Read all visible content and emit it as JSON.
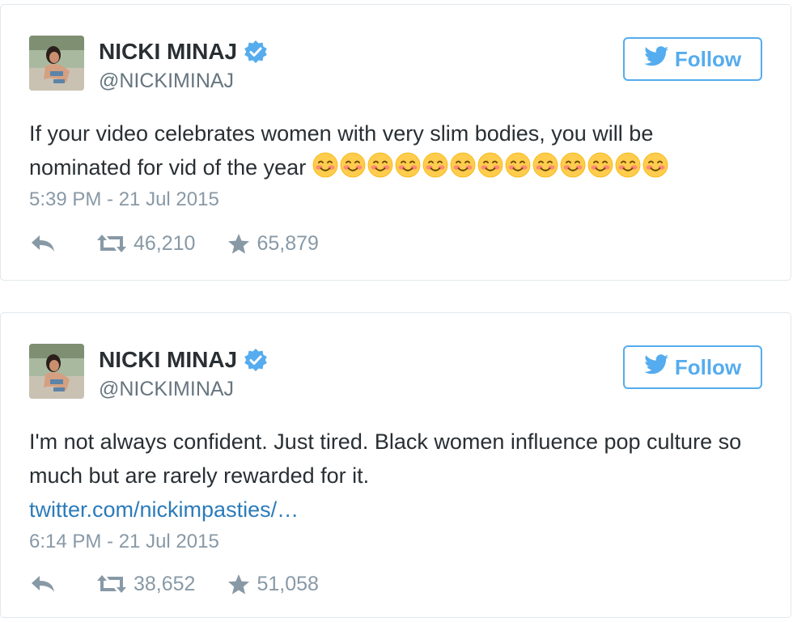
{
  "tweets": [
    {
      "author_name": "NICKI MINAJ",
      "handle": "@NICKIMINAJ",
      "follow_label": "Follow",
      "text": "If your video celebrates women with very slim bodies, you will be nominated for vid of the year",
      "emoji": [
        "blush",
        "blush",
        "blush",
        "blush",
        "blush",
        "blush",
        "blush",
        "blush",
        "blush",
        "blush",
        "blush",
        "blush",
        "blush"
      ],
      "link": "",
      "timestamp": "5:39 PM - 21 Jul 2015",
      "retweets": "46,210",
      "favorites": "65,879"
    },
    {
      "author_name": "NICKI MINAJ",
      "handle": "@NICKIMINAJ",
      "follow_label": "Follow",
      "text": "I'm not always confident.  Just tired. Black women influence pop culture so much but are rarely rewarded for it.",
      "emoji": [],
      "link": "twitter.com/nickimpasties/…",
      "timestamp": "6:14 PM - 21 Jul 2015",
      "retweets": "38,652",
      "favorites": "51,058"
    }
  ],
  "icons": {
    "verified": "verified-badge-icon",
    "bird": "twitter-bird-icon",
    "reply": "reply-icon",
    "retweet": "retweet-icon",
    "favorite": "star-icon",
    "emoji": "blush-emoji"
  },
  "colors": {
    "accent": "#55acee",
    "link": "#2b7bb9",
    "muted": "#8899a6",
    "text": "#292f33"
  }
}
